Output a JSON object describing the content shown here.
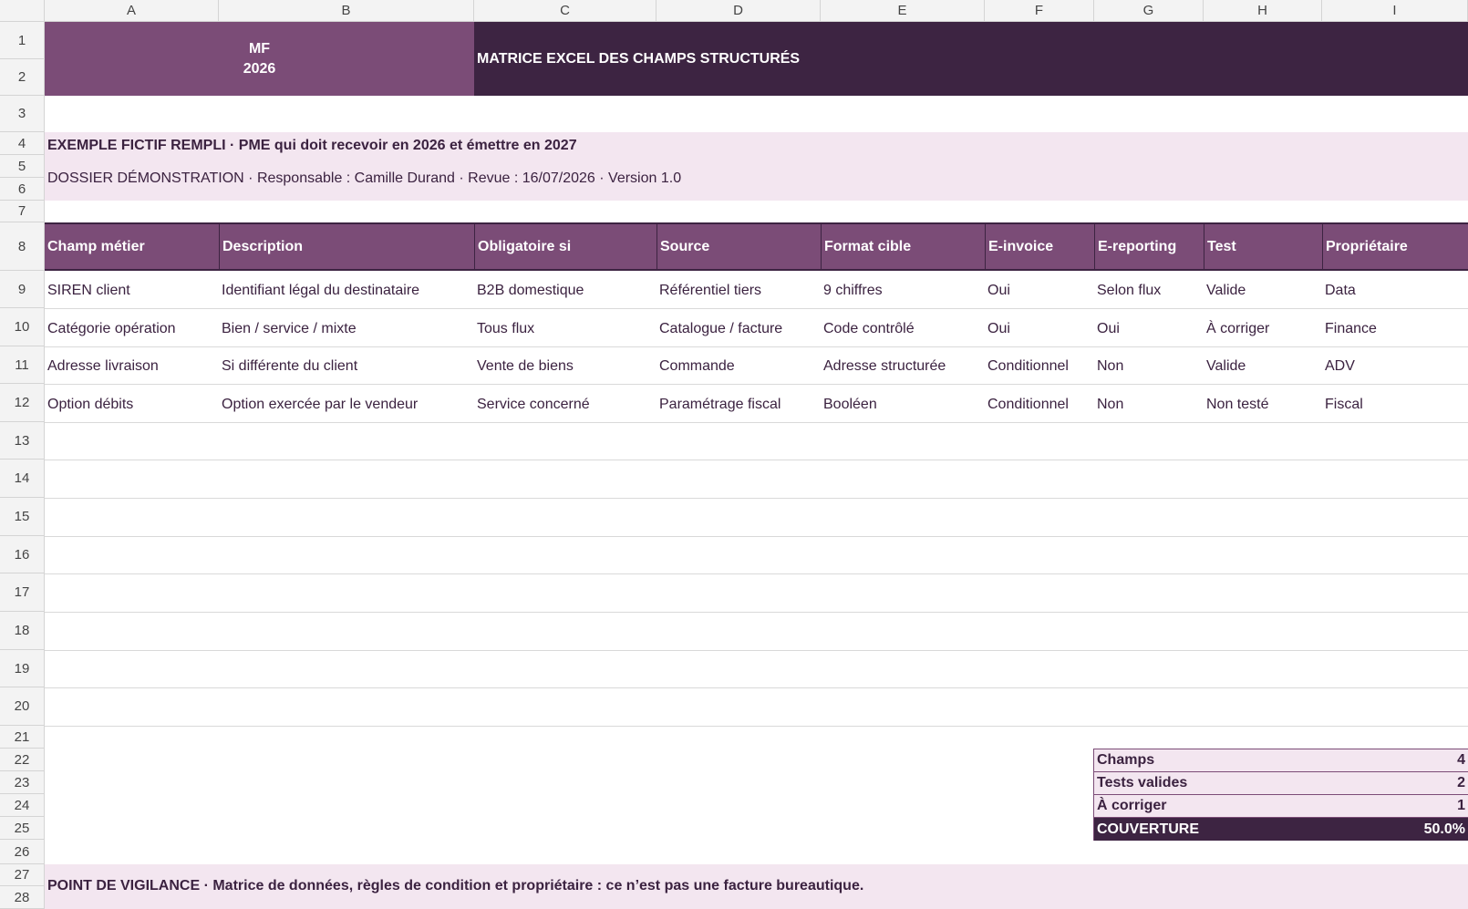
{
  "columns": [
    "A",
    "B",
    "C",
    "D",
    "E",
    "F",
    "G",
    "H",
    "I"
  ],
  "rows": [
    "1",
    "2",
    "3",
    "4",
    "5",
    "6",
    "7",
    "8",
    "9",
    "10",
    "11",
    "12",
    "13",
    "14",
    "15",
    "16",
    "17",
    "18",
    "19",
    "20",
    "21",
    "22",
    "23",
    "24",
    "25",
    "26",
    "27",
    "28"
  ],
  "banner": {
    "left_line1": "MF",
    "left_line2": "2026",
    "title": "MATRICE EXCEL DES CHAMPS STRUCTURÉS"
  },
  "info": {
    "line1": "EXEMPLE FICTIF REMPLI · PME qui doit recevoir en 2026 et émettre en 2027",
    "line2": "DOSSIER DÉMONSTRATION · Responsable : Camille Durand · Revue : 16/07/2026 · Version 1.0"
  },
  "table": {
    "headers": [
      "Champ métier",
      "Description",
      "Obligatoire si",
      "Source",
      "Format cible",
      "E-invoice",
      "E-reporting",
      "Test",
      "Propriétaire"
    ],
    "rows": [
      [
        "SIREN client",
        "Identifiant légal du destinataire",
        "B2B domestique",
        "Référentiel tiers",
        "9 chiffres",
        "Oui",
        "Selon flux",
        "Valide",
        "Data"
      ],
      [
        "Catégorie opération",
        "Bien / service / mixte",
        "Tous flux",
        "Catalogue / facture",
        "Code contrôlé",
        "Oui",
        "Oui",
        "À corriger",
        "Finance"
      ],
      [
        "Adresse livraison",
        "Si différente du client",
        "Vente de biens",
        "Commande",
        "Adresse structurée",
        "Conditionnel",
        "Non",
        "Valide",
        "ADV"
      ],
      [
        "Option débits",
        "Option exercée par le vendeur",
        "Service concerné",
        "Paramétrage fiscal",
        "Booléen",
        "Conditionnel",
        "Non",
        "Non testé",
        "Fiscal"
      ]
    ]
  },
  "summary": [
    {
      "label": "Champs",
      "value": "4"
    },
    {
      "label": "Tests valides",
      "value": "2"
    },
    {
      "label": "À corriger",
      "value": "1"
    },
    {
      "label": "COUVERTURE",
      "value": "50.0%"
    }
  ],
  "vigilance": "POINT DE VIGILANCE · Matrice de données, règles de condition et propriétaire : ce n’est pas une facture bureautique.",
  "colors": {
    "header_purple": "#7b4c77",
    "dark_purple": "#3d2442",
    "light_band": "#f3e6f0"
  }
}
